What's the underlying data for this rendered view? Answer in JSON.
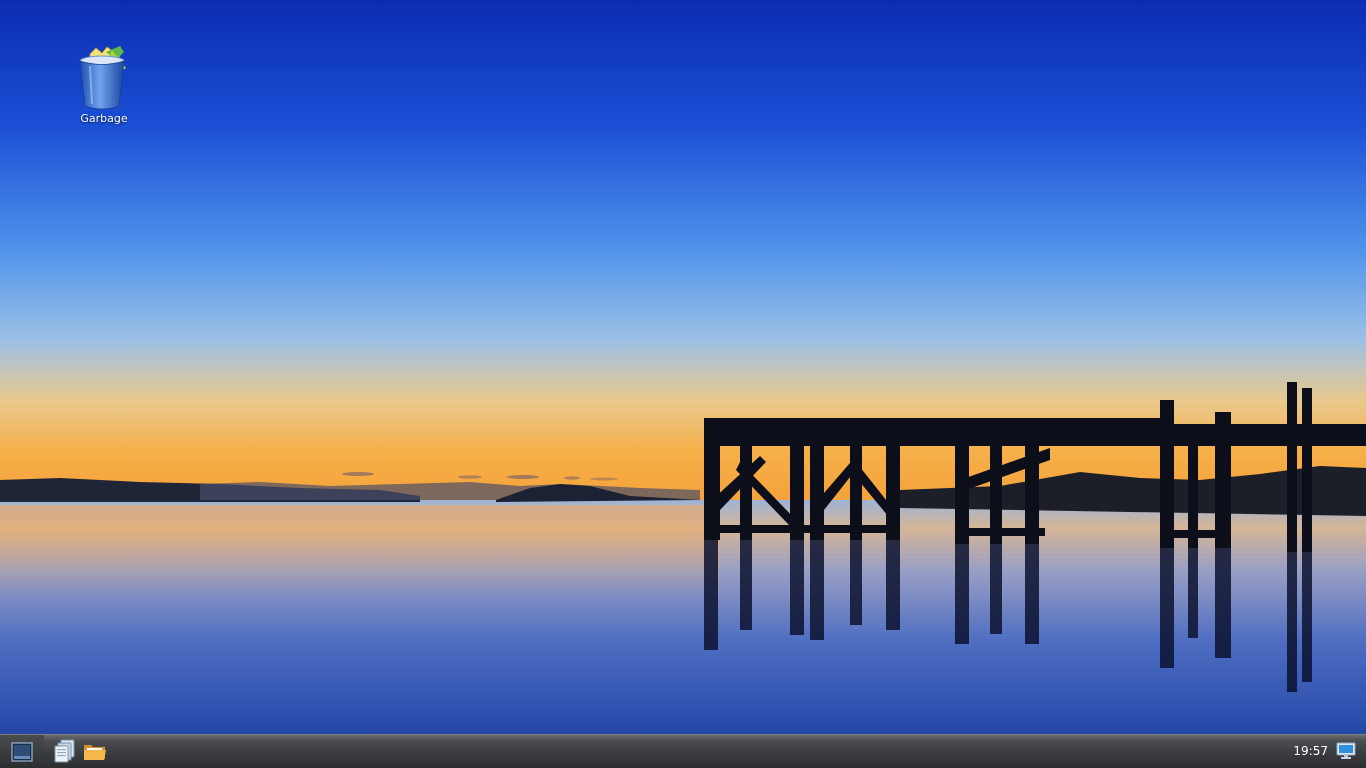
{
  "desktop": {
    "icons": [
      {
        "label": "Garbage",
        "icon": "trash-bin-icon"
      }
    ]
  },
  "taskbar": {
    "start_icon": "start-menu-icon",
    "launchers": [
      {
        "icon": "file-manager-icon"
      },
      {
        "icon": "folder-icon"
      }
    ],
    "clock": "19:57",
    "show_desktop_icon": "monitor-icon"
  },
  "colors": {
    "sky_top": "#0a2fb4",
    "sky_mid": "#4a8de6",
    "horizon": "#f4b25a",
    "water": "#2d4fb8",
    "taskbar": "#3a3c40"
  }
}
